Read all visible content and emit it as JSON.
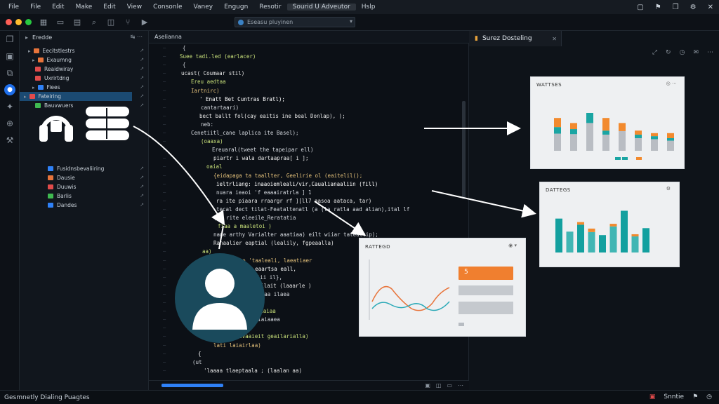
{
  "menubar": {
    "items": [
      "File",
      "File",
      "Edit",
      "Make",
      "Edit",
      "View",
      "Consonle",
      "Vaney",
      "Engugn",
      "Resotir",
      "Sourid U Adveutor",
      "Hslp"
    ],
    "active_index": 10
  },
  "toolbar": {
    "url_text": "Eseasu pluyinen"
  },
  "sidebar": {
    "title": "Eredde",
    "items": [
      {
        "label": "Eecitstlestrs",
        "color": "#e8743b"
      },
      {
        "label": "Exaumng",
        "color": "#e8743b"
      },
      {
        "label": "Reaidwiray",
        "color": "#e14b4b"
      },
      {
        "label": "Uxrirtdng",
        "color": "#e14b4b"
      },
      {
        "label": "Fiees",
        "color": "#2f81f7"
      },
      {
        "label": "Fateiring",
        "color": "#e14b4b"
      },
      {
        "label": "Bauvwuers",
        "color": "#3fb950"
      },
      {
        "label": "Fusidnsbevaliiring",
        "color": "#2f81f7"
      },
      {
        "label": "Dausie",
        "color": "#e8743b"
      },
      {
        "label": "Duuwis",
        "color": "#e14b4b"
      },
      {
        "label": "Barlis",
        "color": "#3fb950"
      },
      {
        "label": "Dandes",
        "color": "#2f81f7"
      }
    ]
  },
  "editor": {
    "tab_label": "Aselianna",
    "lines": [
      "{",
      "Suee tadi.led (earlacer)",
      "{",
      "ucast( Coumaar stil)",
      "Ereu aedtaa",
      "Iartnirc)",
      "' Enatt  Bet Cuntras Bratl);",
      "cantartaari)",
      "bect ballt fol(cay eaitis ine beal Donlap), );",
      "neb:",
      "Cenetiitl_cane laplica ite Basel);",
      "(oaaxa)",
      "Ereuaral(tweet the tapeipar ell)",
      "piartr i wala dartaapraa[ i ];",
      "oaial",
      "{eidapaga ta taallter, Geelirie ol (eaitelil();",
      "ieltrliang: inaaoiemleali/vir,Caualianaaliin (fill)",
      "nuara ieaoi 'f eaaairatrla ] 1",
      "ra ite piaara rraargr  rf ][ll7  aasoa aataca, tar)",
      "tecal dect tilat-Feataltenatl  (a (la ratla aad alian),ital lf",
      "(Ia rite eleeile_Reratatia",
      "fiaa a maaletoi  )",
      "nane arthy Varialter aaatiaa) eilt wiiar tatealtip);",
      "Ranaalier eaptial (lealily, fgpeaalla)",
      "aa)",
      "Cenaarce re 'taaleali, laeatiaer",
      "(Eelicr paaia eaartsa eall,",
      "(ta aaletialaaalii il},",
      "(Raaleatine aeilait (laaarle )",
      "aaaeee: e enillaaa ilaea",
      "(ctaraalarsa);",
      "Bvolpavaalec iarlaiaa",
      "Ellalaaaivid ciaiaaea",
      "rlia aaaa)",
      "te leasaivaaieit geailarialla)",
      "lati laiairlaa)",
      "{",
      "(ut",
      "'laaaa tlaeptaala ;  (laalan aa)"
    ]
  },
  "right_panel": {
    "tab_label": "Surez Dosteling",
    "card1": {
      "title": "WATTSES",
      "bars": [
        {
          "total": 0.65,
          "top": 0.18,
          "mid": 0.13
        },
        {
          "total": 0.55,
          "top": 0.12,
          "mid": 0.1
        },
        {
          "total": 0.75,
          "top": 0.0,
          "mid": 0.2
        },
        {
          "total": 0.65,
          "top": 0.25,
          "mid": 0.08
        },
        {
          "total": 0.55,
          "top": 0.16,
          "mid": 0.0
        },
        {
          "total": 0.4,
          "top": 0.08,
          "mid": 0.07
        },
        {
          "total": 0.35,
          "top": 0.06,
          "mid": 0.06
        },
        {
          "total": 0.35,
          "top": 0.1,
          "mid": 0.05
        }
      ]
    },
    "card2": {
      "title": "DATTEGS",
      "bars": [
        {
          "total": 0.78,
          "top": 0.0
        },
        {
          "total": 0.48,
          "top": 0.0
        },
        {
          "total": 0.7,
          "top": 0.06
        },
        {
          "total": 0.55,
          "top": 0.08
        },
        {
          "total": 0.4,
          "top": 0.0
        },
        {
          "total": 0.66,
          "top": 0.06
        },
        {
          "total": 0.96,
          "top": 0.0
        },
        {
          "total": 0.42,
          "top": 0.05
        },
        {
          "total": 0.56,
          "top": 0.0
        }
      ]
    },
    "card3": {
      "title": "RATTEGD",
      "button_symbol": "5"
    }
  },
  "statusbar": {
    "left_text": "Gesmnetly Dialing Puagtes",
    "right_text": "Snntie"
  }
}
